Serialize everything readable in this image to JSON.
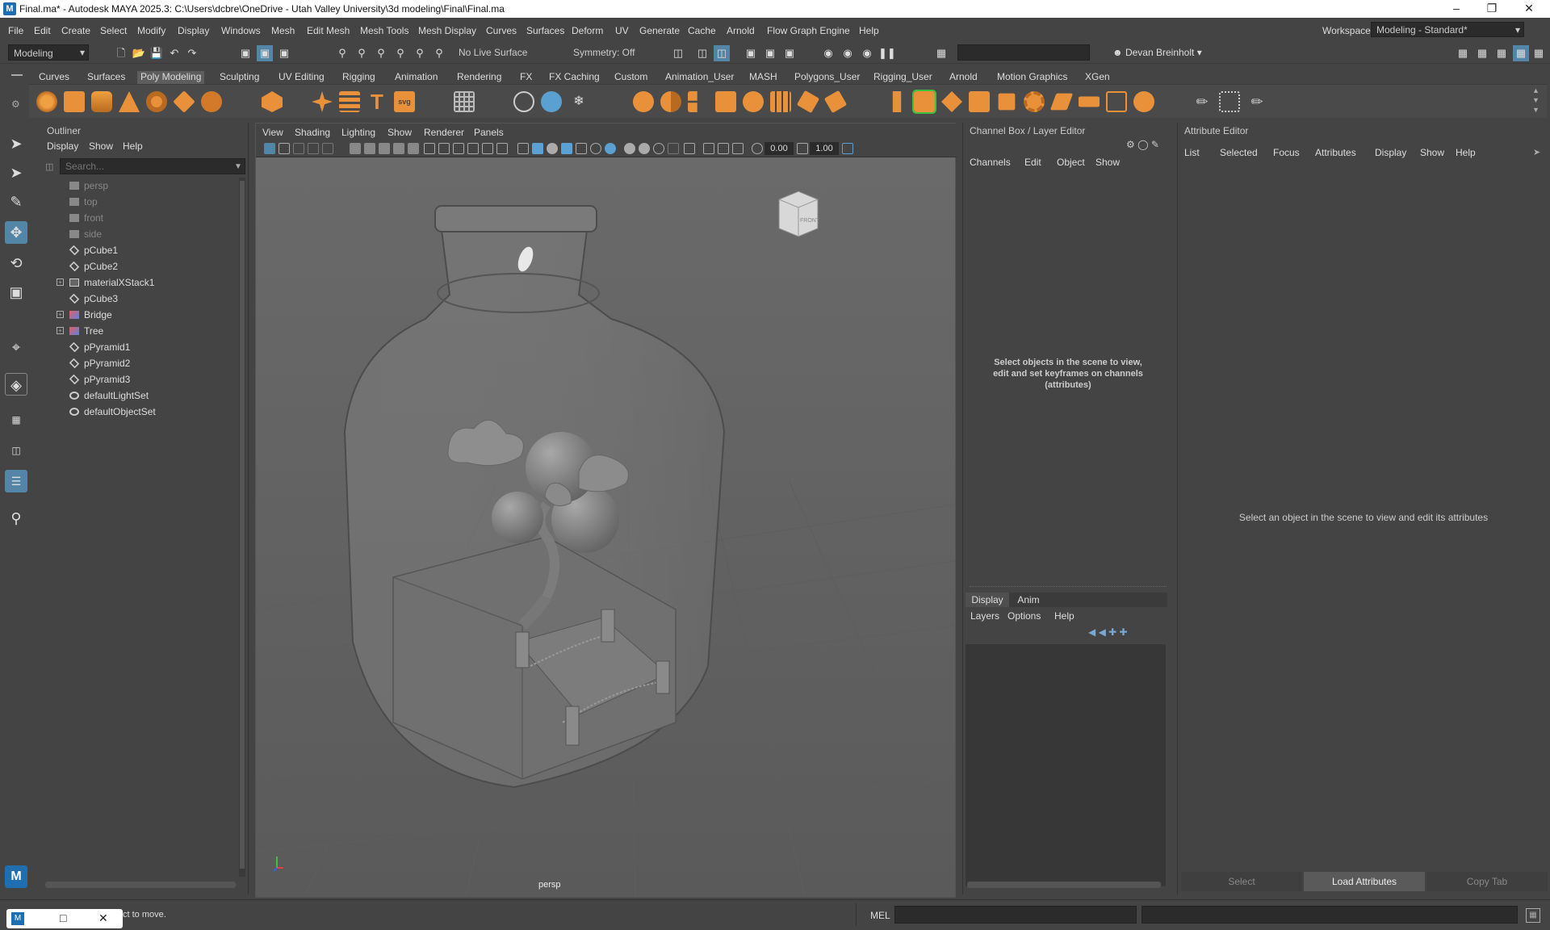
{
  "window": {
    "title": "Final.ma* - Autodesk MAYA 2025.3: C:\\Users\\dcbre\\OneDrive - Utah Valley University\\3d modeling\\Final\\Final.ma"
  },
  "menu": [
    "File",
    "Edit",
    "Create",
    "Select",
    "Modify",
    "Display",
    "Windows",
    "Mesh",
    "Edit Mesh",
    "Mesh Tools",
    "Mesh Display",
    "Curves",
    "Surfaces",
    "Deform",
    "UV",
    "Generate",
    "Cache",
    "Arnold",
    "Flow Graph Engine",
    "Help"
  ],
  "workspace": {
    "label": "Workspace:",
    "value": "Modeling - Standard*"
  },
  "status": {
    "mode": "Modeling",
    "live_surface": "No Live Surface",
    "symmetry": "Symmetry: Off",
    "user": "Devan Breinholt"
  },
  "shelf_tabs": [
    "Curves",
    "Surfaces",
    "Poly Modeling",
    "Sculpting",
    "UV Editing",
    "Rigging",
    "Animation",
    "Rendering",
    "FX",
    "FX Caching",
    "Custom",
    "Animation_User",
    "MASH",
    "Polygons_User",
    "Rigging_User",
    "Arnold",
    "Motion Graphics",
    "XGen"
  ],
  "shelf_active": "Poly Modeling",
  "outliner": {
    "title": "Outliner",
    "menu": [
      "Display",
      "Show",
      "Help"
    ],
    "search_placeholder": "Search...",
    "items": [
      {
        "label": "persp",
        "type": "camera",
        "dim": true
      },
      {
        "label": "top",
        "type": "camera",
        "dim": true
      },
      {
        "label": "front",
        "type": "camera",
        "dim": true
      },
      {
        "label": "side",
        "type": "camera",
        "dim": true
      },
      {
        "label": "pCube1",
        "type": "mesh"
      },
      {
        "label": "pCube2",
        "type": "mesh"
      },
      {
        "label": "materialXStack1",
        "type": "material",
        "expandable": true
      },
      {
        "label": "pCube3",
        "type": "mesh"
      },
      {
        "label": "Bridge",
        "type": "group",
        "expandable": true
      },
      {
        "label": "Tree",
        "type": "group",
        "expandable": true
      },
      {
        "label": "pPyramid1",
        "type": "mesh"
      },
      {
        "label": "pPyramid2",
        "type": "mesh"
      },
      {
        "label": "pPyramid3",
        "type": "mesh"
      },
      {
        "label": "defaultLightSet",
        "type": "set"
      },
      {
        "label": "defaultObjectSet",
        "type": "set"
      }
    ]
  },
  "viewport": {
    "menu": [
      "View",
      "Shading",
      "Lighting",
      "Show",
      "Renderer",
      "Panels"
    ],
    "field_a": "0.00",
    "field_b": "1.00",
    "camera_label": "persp",
    "viewcube_label": "FRONT"
  },
  "channel_box": {
    "title": "Channel Box / Layer Editor",
    "menu": [
      "Channels",
      "Edit",
      "Object",
      "Show"
    ],
    "hint": "Select objects in the scene to view, edit and set keyframes on channels (attributes)",
    "layer_tabs": [
      "Display",
      "Anim"
    ],
    "layer_menu": [
      "Layers",
      "Options",
      "Help"
    ]
  },
  "attribute_editor": {
    "title": "Attribute Editor",
    "menu": [
      "List",
      "Selected",
      "Focus",
      "Attributes",
      "Display",
      "Show",
      "Help"
    ],
    "hint": "Select an object in the scene to view and edit its attributes",
    "buttons": [
      "Select",
      "Load Attributes",
      "Copy Tab"
    ]
  },
  "command": {
    "help_text": "ct to move.",
    "mel_label": "MEL"
  },
  "colors": {
    "accent": "#e8913a",
    "bg": "#444444",
    "field": "#2b2b2b",
    "active_tool": "#5285a6"
  }
}
